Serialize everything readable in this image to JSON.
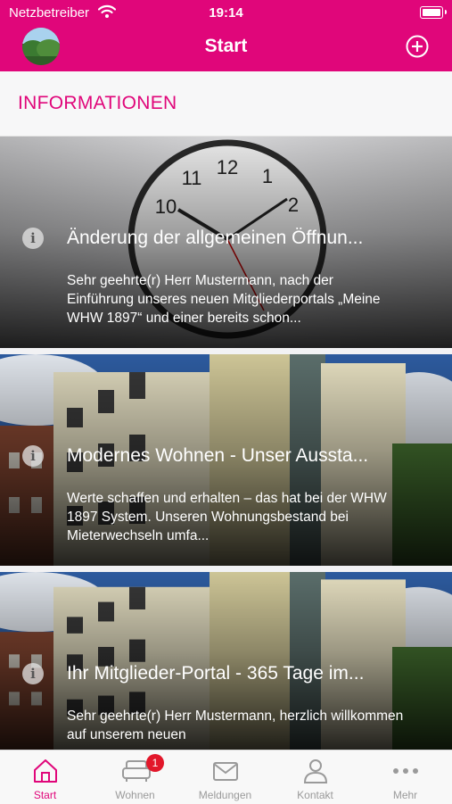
{
  "status_bar": {
    "carrier": "Netzbetreiber",
    "time": "19:14"
  },
  "nav": {
    "title": "Start",
    "avatar": "profile-photo",
    "add_icon": "plus-circle-icon"
  },
  "section": {
    "title": "INFORMATIONEN"
  },
  "cards": [
    {
      "title": "Änderung der allgemeinen Öffnun...",
      "text": "Sehr geehrte(r) Herr Mustermann, nach der Einführung unseres neuen Mitgliederportals „Meine WHW 1897“  und einer bereits schon...",
      "image": "wall-clock-photo",
      "icon": "info-icon"
    },
    {
      "title": "Modernes Wohnen - Unser Aussta...",
      "text": "Werte schaffen und erhalten – das hat bei der WHW 1897 System. Unseren Wohnungsbestand bei Mieterwechseln umfa...",
      "image": "apartment-building-photo",
      "icon": "info-icon"
    },
    {
      "title": "Ihr Mitglieder-Portal - 365 Tage im...",
      "text": "Sehr geehrte(r) Herr Mustermann, herzlich willkommen auf unserem neuen",
      "image": "apartment-building-photo",
      "icon": "info-icon"
    }
  ],
  "tabs": [
    {
      "label": "Start",
      "icon": "home-icon",
      "active": true
    },
    {
      "label": "Wohnen",
      "icon": "sofa-icon",
      "badge": "1"
    },
    {
      "label": "Meldungen",
      "icon": "envelope-icon"
    },
    {
      "label": "Kontakt",
      "icon": "person-icon"
    },
    {
      "label": "Mehr",
      "icon": "more-dots-icon"
    }
  ],
  "colors": {
    "accent": "#e0067a",
    "badge": "#e2172a",
    "tab_inactive": "#9a9a9a"
  }
}
